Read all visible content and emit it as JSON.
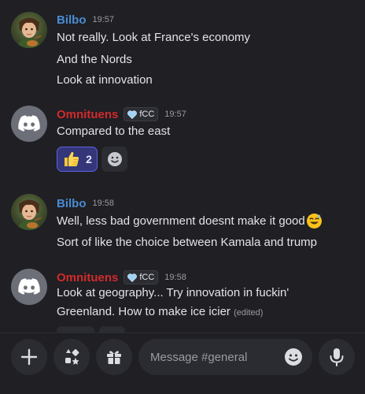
{
  "messages": [
    {
      "username": "Bilbo",
      "time": "19:57",
      "lines": [
        "Not really. Look at France's economy",
        "And the Nords",
        "Look at innovation"
      ]
    },
    {
      "username": "Omnituens",
      "badge": "fCC",
      "time": "19:57",
      "lines": [
        "Compared to the east"
      ],
      "reactions": [
        {
          "emoji": "thumbs-up",
          "count": "2"
        }
      ]
    },
    {
      "username": "Bilbo",
      "time": "19:58",
      "lines": [
        "Well, less bad government doesnt make it good",
        "Sort of like the choice between Kamala and trump"
      ]
    },
    {
      "username": "Omnituens",
      "badge": "fCC",
      "time": "19:58",
      "lines": [
        "Look at geography... Try innovation in fuckin'",
        "Greenland. How to make ice icier"
      ],
      "edited_label": "(edited)"
    }
  ],
  "composer": {
    "placeholder": "Message #general"
  },
  "colors": {
    "background": "#1f1f24",
    "bilbo_name": "#4a8cd3",
    "omnituens_name": "#d22b2b",
    "reaction_active": "#5b62e0",
    "field": "#2b2c31"
  },
  "icons": [
    "plus-icon",
    "apps-icon",
    "gift-icon",
    "emoji-icon",
    "microphone-icon",
    "discord-logo",
    "heart-badge-icon",
    "thumbs-up-emoji",
    "add-reaction-icon",
    "smiling-sweat-emoji"
  ]
}
